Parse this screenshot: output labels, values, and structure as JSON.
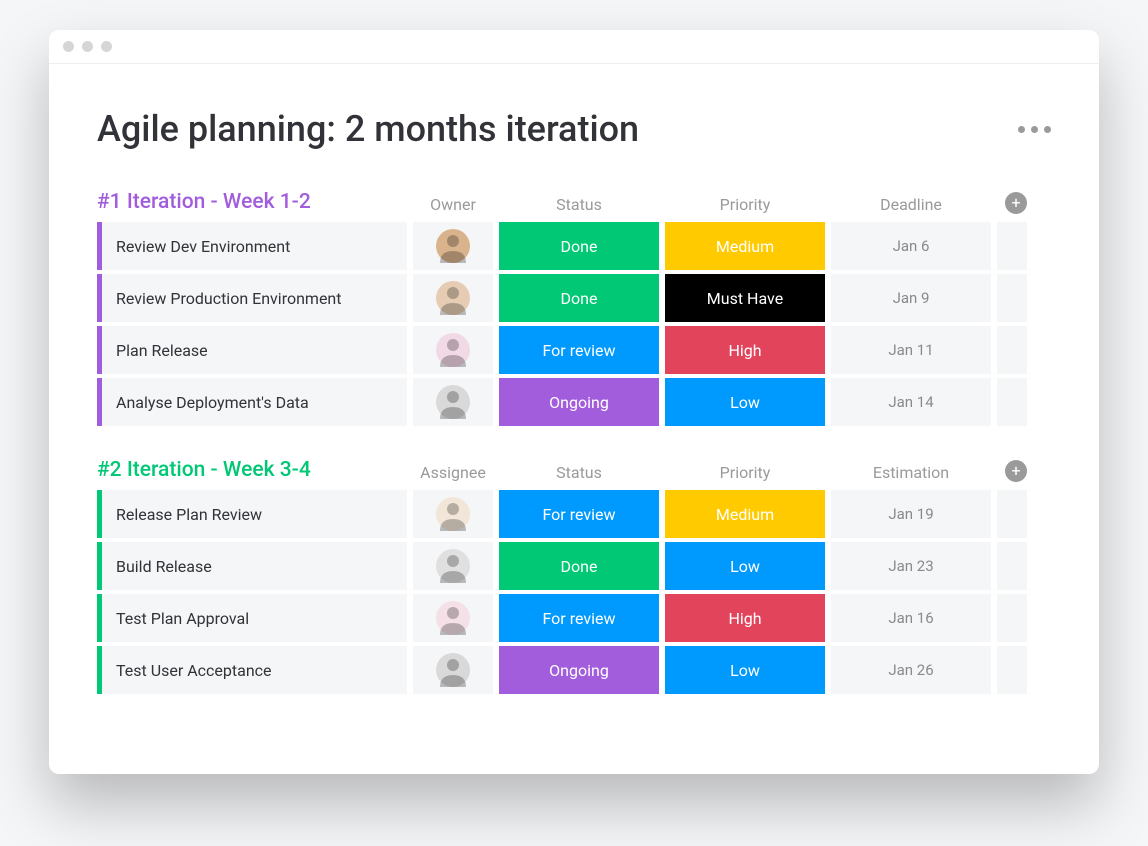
{
  "page": {
    "title": "Agile planning: 2 months iteration"
  },
  "colors": {
    "group1": "#a25ddc",
    "group2": "#00c875",
    "done": "#00c875",
    "for_review": "#009aff",
    "ongoing": "#a25ddc",
    "medium": "#ffcb00",
    "must_have": "#000000",
    "high": "#e2445c",
    "low": "#009aff",
    "header_gray": "#9a9a9a"
  },
  "groups": [
    {
      "title": "#1 Iteration - Week 1-2",
      "titleColorKey": "group1",
      "columns": [
        "Owner",
        "Status",
        "Priority",
        "Deadline"
      ],
      "rows": [
        {
          "task": "Review Dev Environment",
          "avatarClass": "a1",
          "status": {
            "label": "Done",
            "colorKey": "done"
          },
          "priority": {
            "label": "Medium",
            "colorKey": "medium"
          },
          "date": "Jan 6"
        },
        {
          "task": "Review Production Environment",
          "avatarClass": "a2",
          "status": {
            "label": "Done",
            "colorKey": "done"
          },
          "priority": {
            "label": "Must Have",
            "colorKey": "must_have"
          },
          "date": "Jan 9"
        },
        {
          "task": "Plan Release",
          "avatarClass": "a3",
          "status": {
            "label": "For review",
            "colorKey": "for_review"
          },
          "priority": {
            "label": "High",
            "colorKey": "high"
          },
          "date": "Jan 11"
        },
        {
          "task": "Analyse Deployment's Data",
          "avatarClass": "a4",
          "status": {
            "label": "Ongoing",
            "colorKey": "ongoing"
          },
          "priority": {
            "label": "Low",
            "colorKey": "low"
          },
          "date": "Jan 14"
        }
      ]
    },
    {
      "title": "#2 Iteration - Week 3-4",
      "titleColorKey": "group2",
      "columns": [
        "Assignee",
        "Status",
        "Priority",
        "Estimation"
      ],
      "rows": [
        {
          "task": "Release Plan Review",
          "avatarClass": "a5",
          "status": {
            "label": "For review",
            "colorKey": "for_review"
          },
          "priority": {
            "label": "Medium",
            "colorKey": "medium"
          },
          "date": "Jan 19"
        },
        {
          "task": "Build Release",
          "avatarClass": "a6",
          "status": {
            "label": "Done",
            "colorKey": "done"
          },
          "priority": {
            "label": "Low",
            "colorKey": "low"
          },
          "date": "Jan 23"
        },
        {
          "task": "Test Plan Approval",
          "avatarClass": "a7",
          "status": {
            "label": "For review",
            "colorKey": "for_review"
          },
          "priority": {
            "label": "High",
            "colorKey": "high"
          },
          "date": "Jan 16"
        },
        {
          "task": "Test User Acceptance",
          "avatarClass": "a4",
          "status": {
            "label": "Ongoing",
            "colorKey": "ongoing"
          },
          "priority": {
            "label": "Low",
            "colorKey": "low"
          },
          "date": "Jan 26"
        }
      ]
    }
  ]
}
